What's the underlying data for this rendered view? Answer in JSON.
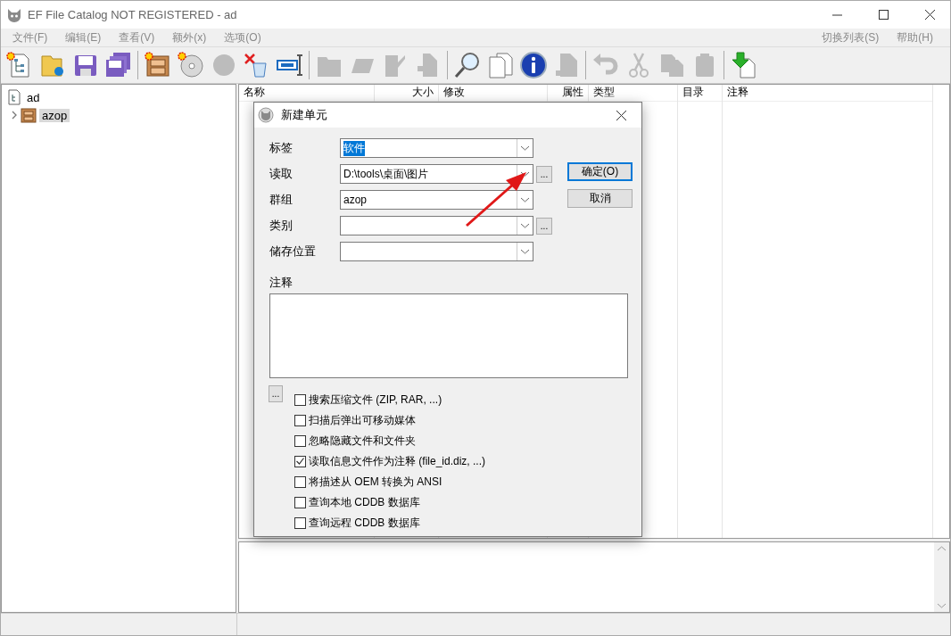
{
  "window": {
    "title": "EF File Catalog NOT REGISTERED - ad"
  },
  "menu": {
    "left": [
      "文件(F)",
      "编辑(E)",
      "查看(V)",
      "额外(x)",
      "选项(O)"
    ],
    "right": [
      "切换列表(S)",
      "帮助(H)"
    ]
  },
  "toolbar": [
    [
      {
        "disabled": false
      },
      {
        "disabled": false
      },
      {
        "disabled": false
      },
      {
        "disabled": false
      }
    ],
    [
      {
        "disabled": false
      },
      {
        "disabled": false
      },
      {
        "disabled": true
      },
      {
        "disabled": false
      },
      {
        "disabled": false
      }
    ],
    [
      {
        "disabled": true
      },
      {
        "disabled": true
      },
      {
        "disabled": true
      },
      {
        "disabled": true
      }
    ],
    [
      {
        "disabled": false
      },
      {
        "disabled": false
      },
      {
        "disabled": false
      },
      {
        "disabled": true
      }
    ],
    [
      {
        "disabled": true
      },
      {
        "disabled": true
      },
      {
        "disabled": true
      },
      {
        "disabled": true
      }
    ],
    [
      {
        "disabled": false
      }
    ]
  ],
  "tree": [
    {
      "label": "ad",
      "children": [
        {
          "label": "azop",
          "selected": true,
          "expanded": false
        }
      ]
    }
  ],
  "table": {
    "columns": [
      "名称",
      "大小",
      "修改",
      "属性",
      "类型",
      "目录",
      "注释"
    ]
  },
  "dialog": {
    "title": "新建单元",
    "fields": [
      {
        "label": "标签",
        "value": "软件",
        "text_selected": true,
        "browse": false
      },
      {
        "label": "读取",
        "value": "D:\\tools\\桌面\\图片",
        "text_selected": false,
        "browse": true
      },
      {
        "label": "群组",
        "value": "azop",
        "text_selected": false,
        "browse": false
      },
      {
        "label": "类别",
        "browse": true
      },
      {
        "label": "储存位置",
        "browse": false
      }
    ],
    "buttons": [
      {
        "label": "确定(O)",
        "default": true
      },
      {
        "label": "取消",
        "default": false
      }
    ],
    "notes_label": "注释",
    "options_button": "...",
    "browse_label": "...",
    "checkboxes": [
      {
        "label": "搜索压缩文件 (ZIP, RAR, ...)",
        "checked": false
      },
      {
        "label": "扫描后弹出可移动媒体",
        "checked": false
      },
      {
        "label": "忽略隐藏文件和文件夹",
        "checked": false
      },
      {
        "label": "读取信息文件作为注释 (file_id.diz, ...)",
        "checked": true
      },
      {
        "label": "将描述从 OEM 转换为 ANSI",
        "checked": false
      },
      {
        "label": "查询本地 CDDB 数据库",
        "checked": false
      },
      {
        "label": "查询远程 CDDB 数据库",
        "checked": false
      }
    ]
  }
}
